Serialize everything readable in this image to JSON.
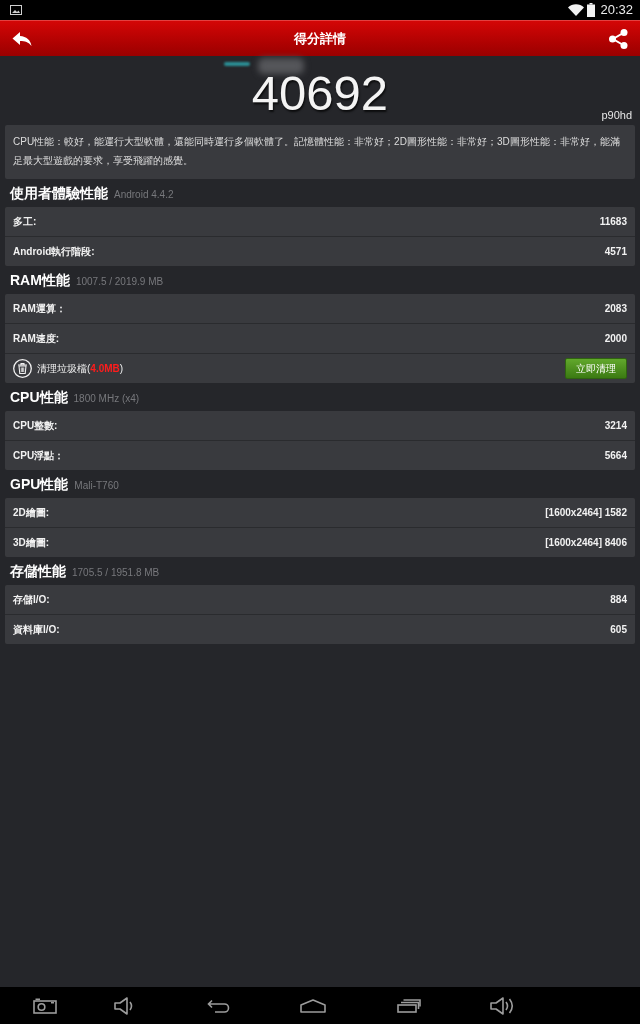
{
  "status_bar": {
    "time": "20:32"
  },
  "app_bar": {
    "title": "得分詳情"
  },
  "score": {
    "value": "40692",
    "device": "p90hd"
  },
  "summary": "CPU性能：較好，能運行大型軟體，還能同時運行多個軟體了。記憶體性能：非常好；2D圖形性能：非常好；3D圖形性能：非常好，能滿足最大型遊戲的要求，享受飛躍的感覺。",
  "sections": [
    {
      "title": "使用者體驗性能",
      "subtitle": "Android 4.4.2",
      "rows": [
        {
          "kind": "metric",
          "label": "多工:",
          "value": "11683"
        },
        {
          "kind": "metric",
          "label": "Android執行階段:",
          "value": "4571"
        }
      ]
    },
    {
      "title": "RAM性能",
      "subtitle": "1007.5 / 2019.9 MB",
      "rows": [
        {
          "kind": "metric",
          "label": "RAM運算：",
          "value": "2083"
        },
        {
          "kind": "metric",
          "label": "RAM速度:",
          "value": "2000"
        },
        {
          "kind": "clean",
          "label": "清理垃圾檔(**4.0MB**)",
          "button": "立即清理"
        }
      ]
    },
    {
      "title": "CPU性能",
      "subtitle": "1800 MHz (x4)",
      "rows": [
        {
          "kind": "metric",
          "label": "CPU整數:",
          "value": "3214"
        },
        {
          "kind": "metric",
          "label": "CPU浮點：",
          "value": "5664"
        }
      ]
    },
    {
      "title": "GPU性能",
      "subtitle": "Mali-T760",
      "rows": [
        {
          "kind": "metric",
          "label": "2D繪圖:",
          "value": "[1600x2464] 1582"
        },
        {
          "kind": "metric",
          "label": "3D繪圖:",
          "value": "[1600x2464] 8406"
        }
      ]
    },
    {
      "title": "存儲性能",
      "subtitle": "1705.5 / 1951.8 MB",
      "rows": [
        {
          "kind": "metric",
          "label": "存儲I/O:",
          "value": "884"
        },
        {
          "kind": "metric",
          "label": "資料庫I/O:",
          "value": "605"
        }
      ]
    }
  ]
}
